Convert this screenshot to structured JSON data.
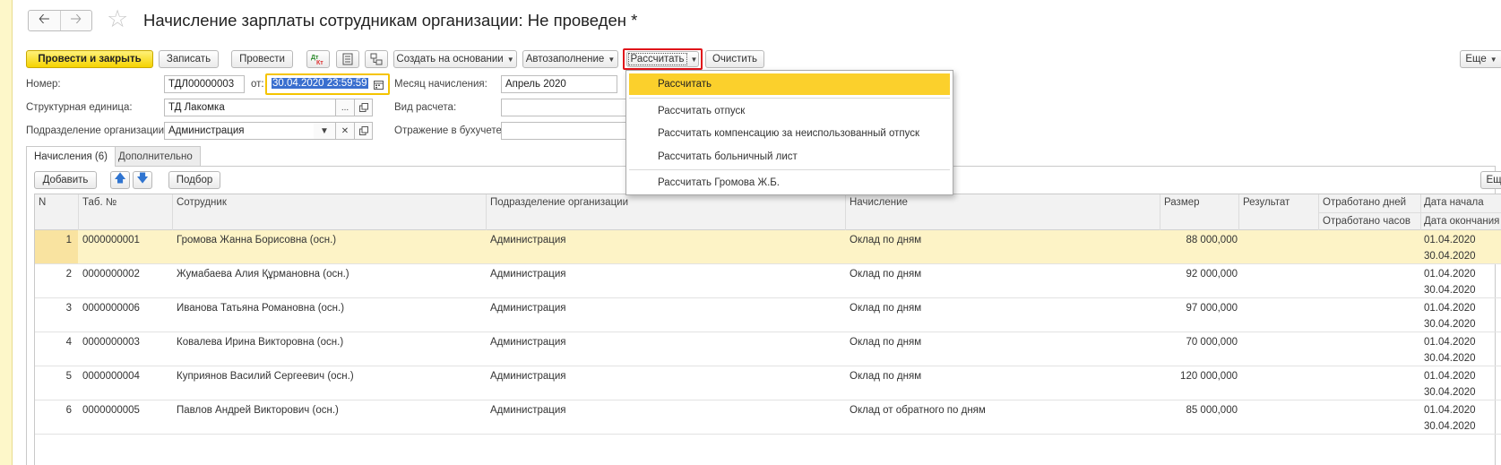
{
  "window": {
    "title": "Начисление зарплаты сотрудникам организации: Не проведен *"
  },
  "toolbar": {
    "post_close": "Провести и закрыть",
    "save": "Записать",
    "post": "Провести",
    "create_based": "Создать на основании",
    "autofill": "Автозаполнение",
    "calculate": "Рассчитать",
    "clear": "Очистить",
    "more": "Еще"
  },
  "form": {
    "number_label": "Номер:",
    "number_value": "ТДЛ00000003",
    "from_label": "от:",
    "date_value": "30.04.2020 23:59:59",
    "month_label": "Месяц начисления:",
    "month_value": "Апрель 2020",
    "unit_label": "Структурная единица:",
    "unit_value": "ТД Лакомка",
    "calc_type_label": "Вид расчета:",
    "dept_label": "Подразделение организации:",
    "dept_value": "Администрация",
    "accounting_label": "Отражение в бухучете:",
    "ellipsis": "..."
  },
  "tabs": [
    {
      "label": "Начисления (6)"
    },
    {
      "label": "Дополнительно"
    }
  ],
  "table_toolbar": {
    "add": "Добавить",
    "pick": "Подбор",
    "more": "Ещ"
  },
  "columns": {
    "n": "N",
    "tab": "Таб. №",
    "employee": "Сотрудник",
    "dept": "Подразделение организации",
    "accrual": "Начисление",
    "size": "Размер",
    "result": "Результат",
    "days": "Отработано дней",
    "hours": "Отработано часов",
    "date_start": "Дата начала",
    "date_end": "Дата окончания"
  },
  "rows": [
    {
      "n": "1",
      "tab": "0000000001",
      "employee": "Громова Жанна Борисовна (осн.)",
      "dept": "Администрация",
      "accrual": "Оклад по дням",
      "size": "88 000,000",
      "start": "01.04.2020",
      "end": "30.04.2020"
    },
    {
      "n": "2",
      "tab": "0000000002",
      "employee": "Жумабаева Алия Құрмановна (осн.)",
      "dept": "Администрация",
      "accrual": "Оклад по дням",
      "size": "92 000,000",
      "start": "01.04.2020",
      "end": "30.04.2020"
    },
    {
      "n": "3",
      "tab": "0000000006",
      "employee": "Иванова Татьяна Романовна (осн.)",
      "dept": "Администрация",
      "accrual": "Оклад по дням",
      "size": "97 000,000",
      "start": "01.04.2020",
      "end": "30.04.2020"
    },
    {
      "n": "4",
      "tab": "0000000003",
      "employee": "Ковалева Ирина Викторовна (осн.)",
      "dept": "Администрация",
      "accrual": "Оклад по дням",
      "size": "70 000,000",
      "start": "01.04.2020",
      "end": "30.04.2020"
    },
    {
      "n": "5",
      "tab": "0000000004",
      "employee": "Куприянов Василий Сергеевич (осн.)",
      "dept": "Администрация",
      "accrual": "Оклад по дням",
      "size": "120 000,000",
      "start": "01.04.2020",
      "end": "30.04.2020"
    },
    {
      "n": "6",
      "tab": "0000000005",
      "employee": "Павлов Андрей Викторович (осн.)",
      "dept": "Администрация",
      "accrual": "Оклад от обратного по дням",
      "size": "85 000,000",
      "start": "01.04.2020",
      "end": "30.04.2020"
    }
  ],
  "menu": {
    "items": [
      "Рассчитать",
      "Рассчитать отпуск",
      "Рассчитать компенсацию за неиспользованный отпуск",
      "Рассчитать больничный лист",
      "Рассчитать Громова Ж.Б."
    ]
  },
  "colors": {
    "accent_yellow": "#f5d300",
    "menu_highlight": "#fbd02c",
    "selected_row": "#fdf3c6",
    "red_frame": "#e0141a"
  }
}
